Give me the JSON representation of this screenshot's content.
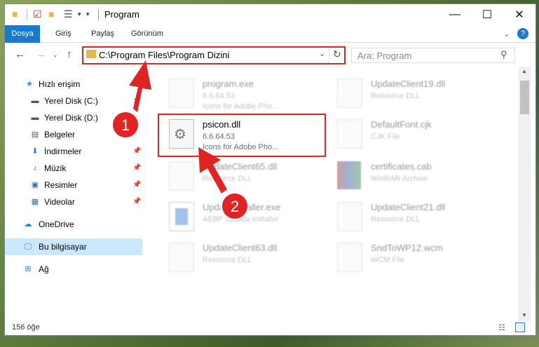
{
  "title": "Program",
  "ribbon": {
    "tabs": [
      "Dosya",
      "Giriş",
      "Paylaş",
      "Görünüm"
    ]
  },
  "address": {
    "path": "C:\\Program Files\\Program Dizini"
  },
  "search": {
    "placeholder": "Ara: Program"
  },
  "sidebar": {
    "items": [
      {
        "label": "Hızlı erişim",
        "icon": "star-icon"
      },
      {
        "label": "Yerel Disk (C:)",
        "icon": "drive-icon"
      },
      {
        "label": "Yerel Disk (D:)",
        "icon": "drive-icon"
      },
      {
        "label": "Belgeler",
        "icon": "documents-icon"
      },
      {
        "label": "İndirmeler",
        "icon": "download-icon"
      },
      {
        "label": "Müzik",
        "icon": "music-icon"
      },
      {
        "label": "Resimler",
        "icon": "pictures-icon"
      },
      {
        "label": "Videolar",
        "icon": "videos-icon"
      },
      {
        "label": "OneDrive",
        "icon": "cloud-icon"
      },
      {
        "label": "Bu bilgisayar",
        "icon": "computer-icon"
      },
      {
        "label": "Ağ",
        "icon": "network-icon"
      }
    ]
  },
  "files": [
    {
      "name": "program.exe",
      "l2": "6.6.64.53",
      "l3": "Icons for Adobe Pho..."
    },
    {
      "name": "UpdateClient19.dll",
      "l2": "Resource DLL",
      "l3": ""
    },
    {
      "name": "psicon.dll",
      "l2": "6.6.64.53",
      "l3": "Icons for Adobe Pho..."
    },
    {
      "name": "DefaultFont.cjk",
      "l2": "CJK File",
      "l3": ""
    },
    {
      "name": "UpdateClient65.dll",
      "l2": "Resource DLL",
      "l3": ""
    },
    {
      "name": "certificates.cab",
      "l2": "WinRAR Archive",
      "l3": ""
    },
    {
      "name": "UpdateInstaller.exe",
      "l2": "AEBP Update installer",
      "l3": ""
    },
    {
      "name": "UpdateClient21.dll",
      "l2": "Resource DLL",
      "l3": ""
    },
    {
      "name": "UpdateClient63.dll",
      "l2": "Resource DLL",
      "l3": ""
    },
    {
      "name": "SndToWP12.wcm",
      "l2": "WCM File",
      "l3": ""
    }
  ],
  "annotations": {
    "step1": "1",
    "step2": "2"
  },
  "status": {
    "count": "156 öğe"
  },
  "colors": {
    "accent": "#1979ca",
    "highlight": "#e02424",
    "selected": "#cce8ff"
  }
}
